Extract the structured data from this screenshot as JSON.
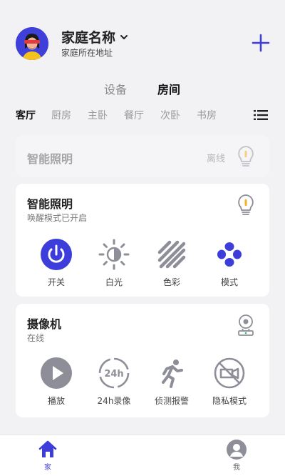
{
  "header": {
    "home_name": "家庭名称",
    "home_address": "家庭所在地址"
  },
  "view_tabs": {
    "devices": "设备",
    "rooms": "房间",
    "active": "rooms"
  },
  "room_tabs": [
    "客厅",
    "厨房",
    "主卧",
    "餐厅",
    "次卧",
    "书房"
  ],
  "active_room": "客厅",
  "cards": {
    "offline_device": {
      "title": "智能照明",
      "status": "离线"
    },
    "smart_light": {
      "title": "智能照明",
      "subtitle": "唤醒模式已开启",
      "controls": [
        "开关",
        "白光",
        "色彩",
        "模式"
      ]
    },
    "camera": {
      "title": "摄像机",
      "subtitle": "在线",
      "controls": [
        "播放",
        "24h录像",
        "侦测报警",
        "隐私模式"
      ],
      "badge_24h": "24h"
    }
  },
  "bottom_nav": {
    "home": "家",
    "me": "我"
  },
  "colors": {
    "accent": "#3d3ddb",
    "icon_gray": "#8e8e98",
    "background": "#f2f2f4"
  }
}
